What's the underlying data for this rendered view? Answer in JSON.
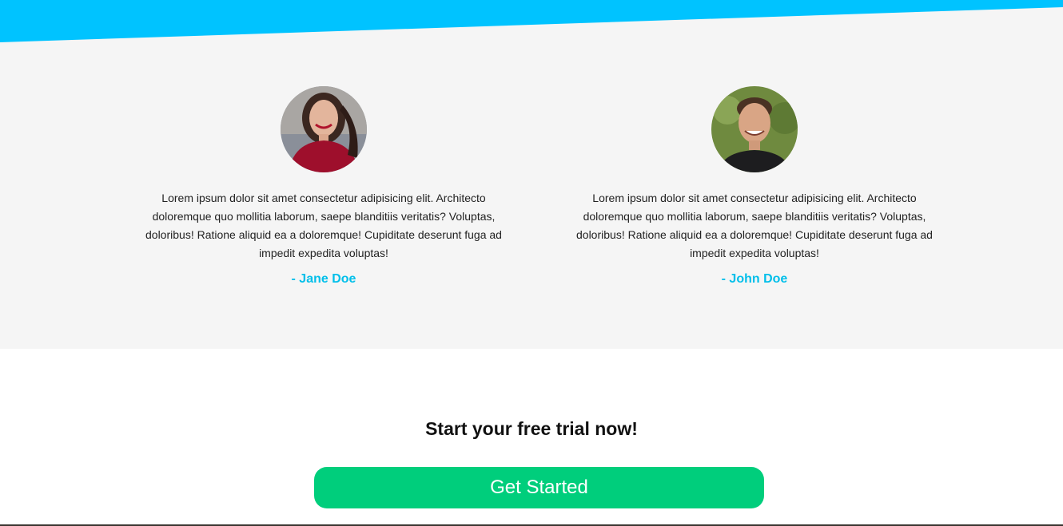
{
  "colors": {
    "accent_blue": "#00c3ff",
    "section_bg": "#f5f5f5",
    "author_color": "#00bfea",
    "cta_green": "#00ce7c"
  },
  "testimonials": [
    {
      "avatar_icon": "woman-portrait-avatar",
      "quote": "Lorem ipsum dolor sit amet consectetur adipisicing elit. Architecto doloremque quo mollitia laborum, saepe blanditiis veritatis? Voluptas, doloribus! Ratione aliquid ea a doloremque! Cupiditate deserunt fuga ad impedit expedita voluptas!",
      "author": "- Jane Doe"
    },
    {
      "avatar_icon": "man-portrait-avatar",
      "quote": "Lorem ipsum dolor sit amet consectetur adipisicing elit. Architecto doloremque quo mollitia laborum, saepe blanditiis veritatis? Voluptas, doloribus! Ratione aliquid ea a doloremque! Cupiditate deserunt fuga ad impedit expedita voluptas!",
      "author": "- John Doe"
    }
  ],
  "cta": {
    "title": "Start your free trial now!",
    "button_label": "Get Started"
  }
}
